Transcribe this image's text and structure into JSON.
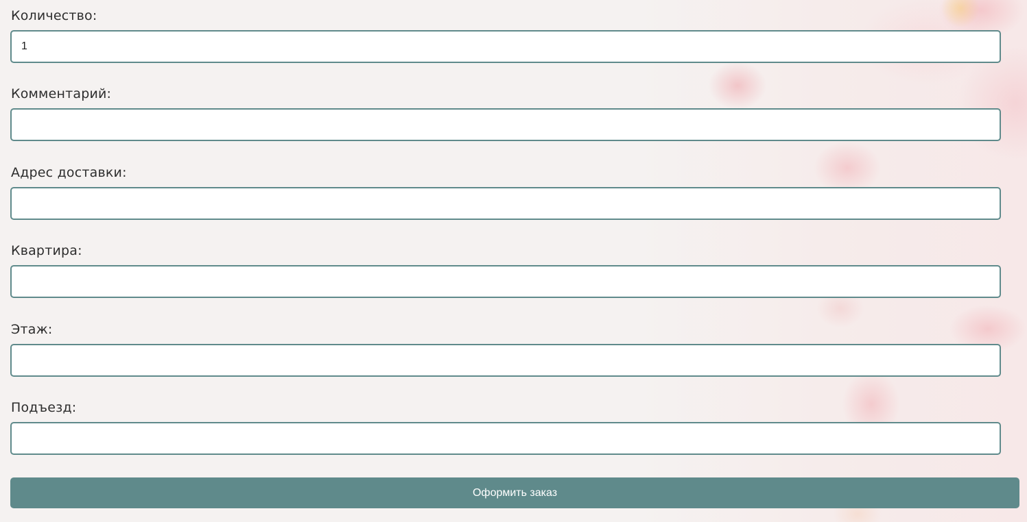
{
  "form": {
    "fields": [
      {
        "label": "Количество:",
        "value": "1",
        "placeholder": ""
      },
      {
        "label": "Комментарий:",
        "value": "",
        "placeholder": ""
      },
      {
        "label": "Адрес доставки:",
        "value": "",
        "placeholder": ""
      },
      {
        "label": "Квартира:",
        "value": "",
        "placeholder": ""
      },
      {
        "label": "Этаж:",
        "value": "",
        "placeholder": ""
      },
      {
        "label": "Подъезд:",
        "value": "",
        "placeholder": ""
      }
    ],
    "submit_label": "Оформить заказ"
  },
  "colors": {
    "accent": "#5f8a8b",
    "input_background": "#ffffff",
    "text": "#2d2d2d"
  }
}
